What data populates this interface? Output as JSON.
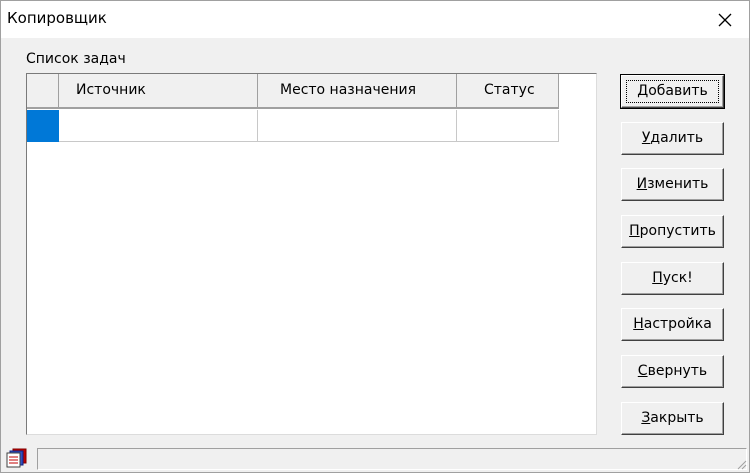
{
  "window": {
    "title": "Копировщик"
  },
  "tasks": {
    "group_label": "Список задач",
    "columns": [
      "Источник",
      "Место назначения",
      "Статус"
    ],
    "rows": [
      [
        "",
        "",
        ""
      ]
    ],
    "selection_color": "#0078d7"
  },
  "buttons": {
    "add": "Добавить",
    "delete": "Удалить",
    "edit": "Изменить",
    "skip": "Пропустить",
    "start": "Пуск!",
    "settings": "Настройка",
    "minimize": "Свернуть",
    "close": "Закрыть"
  },
  "statusbar": {
    "icon": "copy-app-icon",
    "text": ""
  }
}
